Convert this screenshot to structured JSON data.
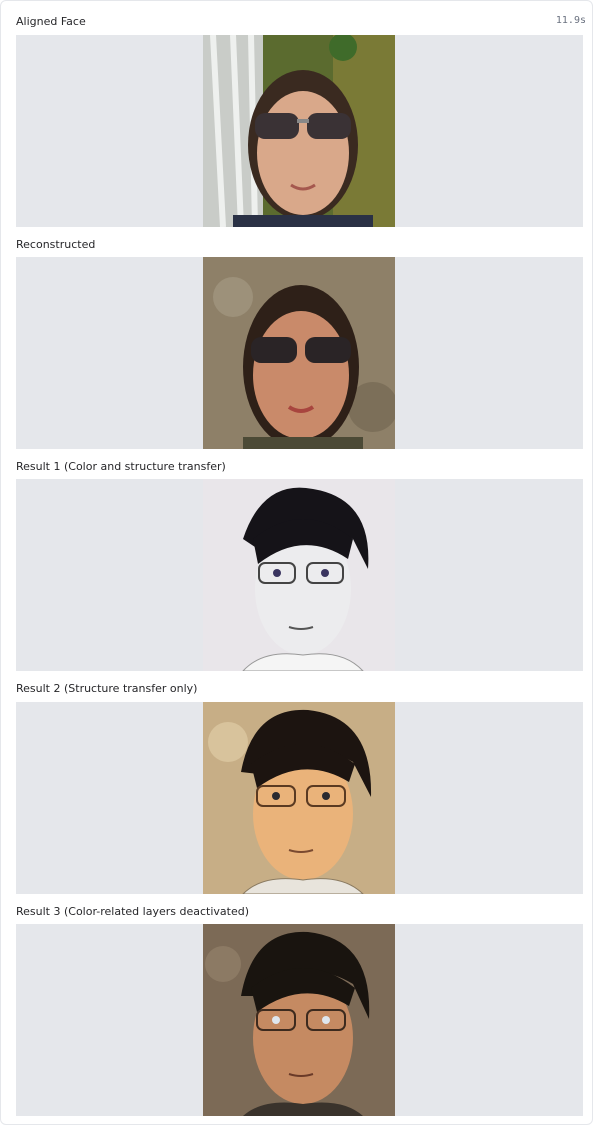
{
  "timer": "11.9s",
  "outputs": [
    {
      "label": "Aligned Face",
      "image": "photo of man with sunglasses in front of waterfall"
    },
    {
      "label": "Reconstructed",
      "image": "reconstructed photo of man with sunglasses against stone wall"
    },
    {
      "label": "Result 1 (Color and structure transfer)",
      "image": "manga-style grayscale portrait with glasses"
    },
    {
      "label": "Result 2 (Structure transfer only)",
      "image": "manga-style portrait with warm skin tones"
    },
    {
      "label": "Result 3 (Color-related layers deactivated)",
      "image": "manga-style portrait with muted photographic tones"
    }
  ]
}
